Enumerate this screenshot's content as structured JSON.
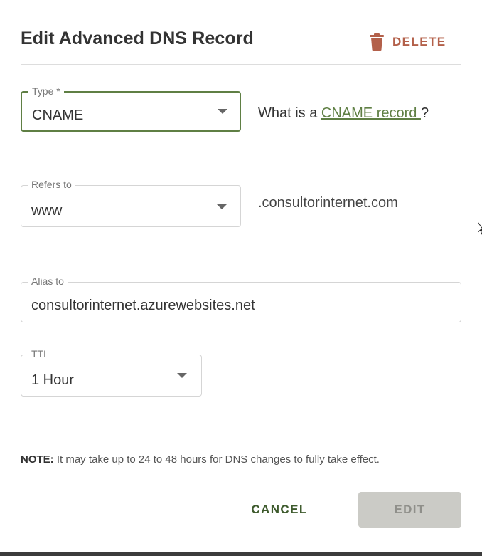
{
  "dialog": {
    "title": "Edit Advanced DNS Record",
    "delete_label": "DELETE"
  },
  "type_field": {
    "label": "Type *",
    "value": "CNAME"
  },
  "help": {
    "prefix": "What is a ",
    "link_text": "CNAME record ",
    "suffix": "?"
  },
  "refers_field": {
    "label": "Refers to",
    "value": "www"
  },
  "domain_suffix": ".consultorinternet.com",
  "alias_field": {
    "label": "Alias to",
    "value": "consultorinternet.azurewebsites.net"
  },
  "ttl_field": {
    "label": "TTL",
    "value": "1 Hour"
  },
  "note": {
    "prefix": "NOTE:",
    "text": " It may take up to 24 to 48 hours for DNS changes to fully take effect."
  },
  "actions": {
    "cancel_label": "CANCEL",
    "edit_label": "EDIT"
  },
  "colors": {
    "accent_green": "#5f7f44",
    "delete_red": "#b3604a",
    "disabled_bg": "#cbcbc6"
  },
  "icons": {
    "delete": "trash-icon",
    "dropdown": "caret-down-icon",
    "cursor": "mouse-pointer-icon"
  }
}
